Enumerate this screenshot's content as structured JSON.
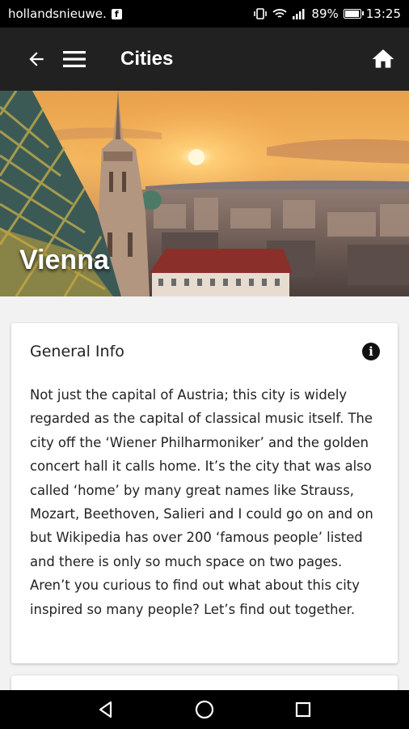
{
  "status_bar": {
    "carrier_text": "hollandsnieuwe.",
    "notification_icon": "facebook-icon",
    "battery": "89%",
    "time": "13:25"
  },
  "app_bar": {
    "title": "Cities",
    "back_icon": "arrow-back-icon",
    "menu_icon": "hamburger-menu-icon",
    "home_icon": "home-icon",
    "background": "#212121"
  },
  "hero": {
    "city_name": "Vienna"
  },
  "general_info": {
    "heading": "General Info",
    "icon": "info-icon",
    "text": "Not just the capital of Austria; this city is widely regarded as the capital of classical music itself. The city off the ‘Wiener Philharmoniker’ and the golden concert hall it calls home. It’s the city that was also called ‘home’ by many great names like Strauss, Mozart, Beethoven, Salieri and I could go on and on but Wikipedia has over 200 ‘famous people’ listed and there is only so much space on two pages. Aren’t you curious to find out what about this city inspired so many people? Let’s find out together."
  },
  "nav_bar": {
    "back": "triangle-back-icon",
    "home": "circle-home-icon",
    "recents": "square-recents-icon"
  }
}
